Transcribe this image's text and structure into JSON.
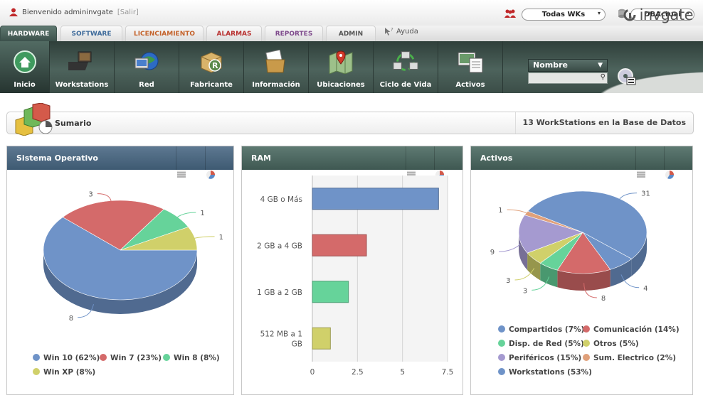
{
  "topbar": {
    "welcome": "Bienvenido admininvgate",
    "logout": "[Salir]",
    "wks_select": "Todas WKs",
    "db_select": "DBActual"
  },
  "tabs": [
    {
      "label": "HARDWARE",
      "color": "#ffffff",
      "active": true
    },
    {
      "label": "SOFTWARE",
      "color": "#3d6a9a"
    },
    {
      "label": "LICENCIAMIENTO",
      "color": "#c4622a"
    },
    {
      "label": "ALARMAS",
      "color": "#b8302f"
    },
    {
      "label": "REPORTES",
      "color": "#7e4a8c"
    },
    {
      "label": "ADMIN",
      "color": "#555555"
    }
  ],
  "help": "Ayuda",
  "logo": "invgate",
  "nav": [
    {
      "label": "Inicio",
      "icon": "home-icon"
    },
    {
      "label": "Workstations",
      "icon": "workstations-icon"
    },
    {
      "label": "Red",
      "icon": "network-globe-icon"
    },
    {
      "label": "Fabricante",
      "icon": "manufacturer-box-icon"
    },
    {
      "label": "Información",
      "icon": "information-folder-icon"
    },
    {
      "label": "Ubicaciones",
      "icon": "map-pin-icon"
    },
    {
      "label": "Ciclo de Vida",
      "icon": "lifecycle-icon"
    },
    {
      "label": "Activos",
      "icon": "assets-icon"
    }
  ],
  "search": {
    "field": "Nombre",
    "value": ""
  },
  "summary": {
    "title": "Sumario",
    "count": "13 WorkStations en la Base de Datos"
  },
  "panels": [
    {
      "title": "Sistema Operativo",
      "chart_data": {
        "type": "pie",
        "labels": [
          "Win 10",
          "Win 7",
          "Win 8",
          "Win XP"
        ],
        "values": [
          8,
          3,
          1,
          1
        ],
        "colors": [
          "#6f93c8",
          "#d46a6a",
          "#66d39a",
          "#d0d06a"
        ],
        "legend": [
          "Win 10 (62%)",
          "Win 7 (23%)",
          "Win 8 (8%)",
          "Win XP (8%)"
        ]
      }
    },
    {
      "title": "RAM",
      "chart_data": {
        "type": "bar",
        "categories": [
          "4 GB o Más",
          "2 GB a 4 GB",
          "1 GB a 2 GB",
          "512 MB a 1 GB"
        ],
        "values": [
          7,
          3,
          2,
          1
        ],
        "colors": [
          "#6f93c8",
          "#d46a6a",
          "#66d39a",
          "#d0d06a"
        ],
        "xticks": [
          "0",
          "2.5",
          "5",
          "7.5"
        ],
        "xlim": [
          0,
          8
        ]
      }
    },
    {
      "title": "Activos",
      "chart_data": {
        "type": "pie",
        "labels": [
          "Compartidos",
          "Comunicación",
          "Disp. de Red",
          "Otros",
          "Periféricos",
          "Sum. Electrico",
          "Workstations"
        ],
        "values": [
          4,
          8,
          3,
          3,
          9,
          1,
          31
        ],
        "colors": [
          "#6f93c8",
          "#d46a6a",
          "#66d39a",
          "#d0d06a",
          "#a59ad0",
          "#e0a07a",
          "#6f93c8"
        ],
        "legend": [
          "Compartidos (7%)",
          "Comunicación (14%)",
          "Disp. de Red (5%)",
          "Otros (5%)",
          "Periféricos (15%)",
          "Sum. Electrico (2%)",
          "Workstations (53%)"
        ]
      }
    }
  ]
}
